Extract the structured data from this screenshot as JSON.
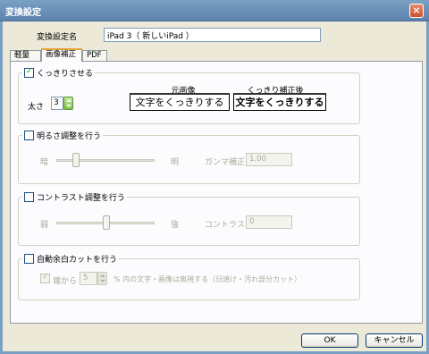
{
  "window": {
    "title": "変換設定",
    "close_label": "×"
  },
  "preset": {
    "label": "変換設定名",
    "value": "iPad 3（ 新しいiPad ）"
  },
  "tabs": [
    {
      "label": "軽量化"
    },
    {
      "label": "画像補正",
      "active": true
    },
    {
      "label": "PDF"
    }
  ],
  "sharpen": {
    "label": "くっきりさせる",
    "checked": true,
    "thickness_label": "太さ",
    "thickness_value": "3",
    "original_label": "元画像",
    "after_label": "くっきり補正後",
    "original_text": "文字をくっきりする",
    "after_text": "文字をくっきりする"
  },
  "brightness": {
    "label": "明るさ調整を行う",
    "checked": false,
    "dark_label": "暗",
    "bright_label": "明",
    "gamma_label": "ガンマ補正",
    "gamma_value": "1.00",
    "slider_position": 0.2
  },
  "contrast": {
    "label": "コントラスト調整を行う",
    "checked": false,
    "weak_label": "弱",
    "strong_label": "強",
    "value_label": "コントラスト",
    "value": "0",
    "slider_position": 0.5
  },
  "autocrop": {
    "label": "自動余白カットを行う",
    "checked": false,
    "edge_label": "端から",
    "edge_checked": true,
    "edge_value": "5",
    "description": "% 内の文字・画像は無視する（日焼け・汚れ部分カット）"
  },
  "buttons": {
    "ok": "OK",
    "cancel": "キャンセル"
  }
}
